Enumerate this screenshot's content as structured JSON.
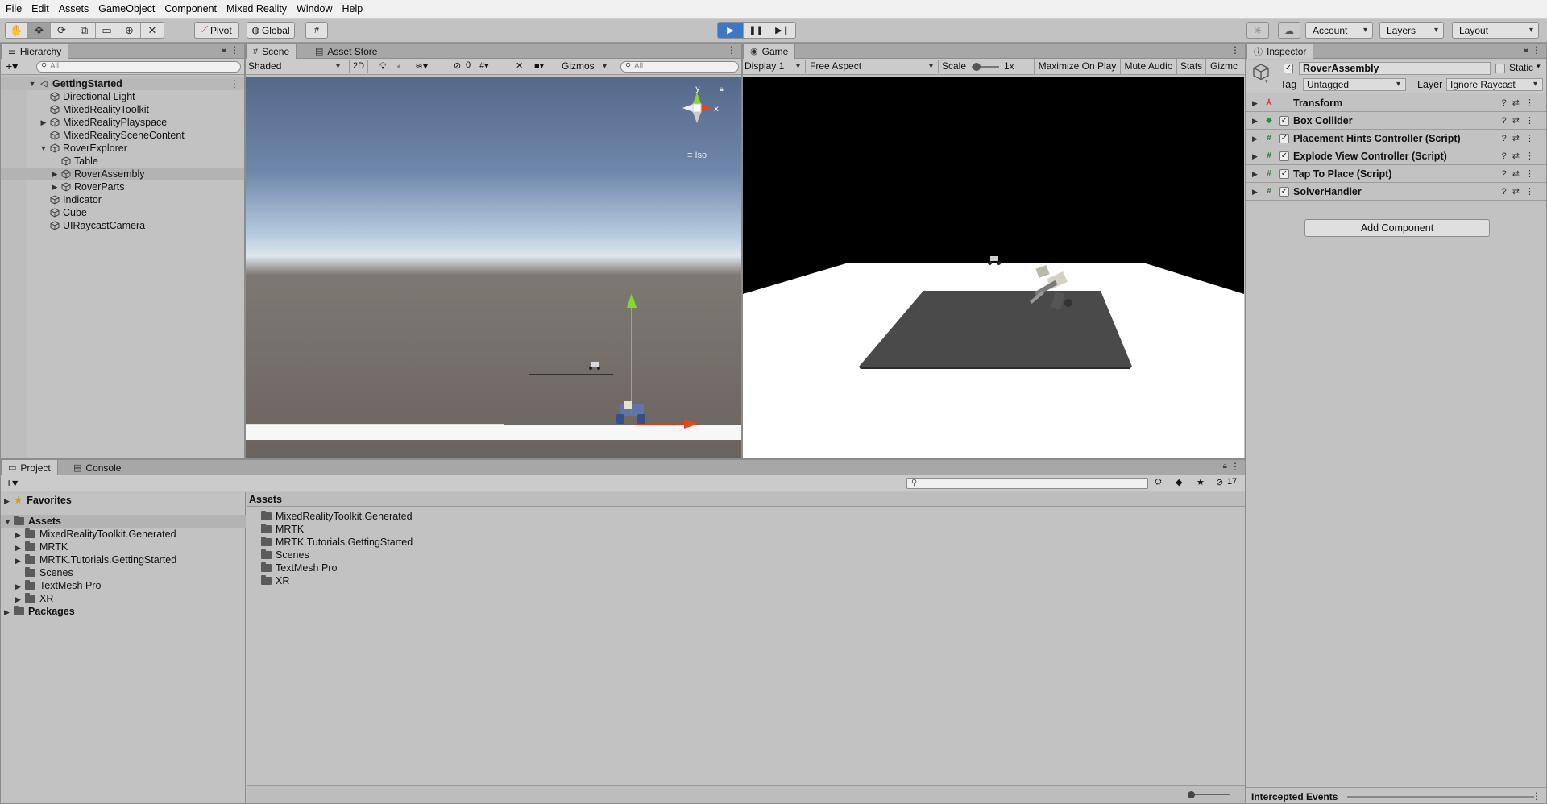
{
  "menu": [
    "File",
    "Edit",
    "Assets",
    "GameObject",
    "Component",
    "Mixed Reality",
    "Window",
    "Help"
  ],
  "toolbar": {
    "pivot": "Pivot",
    "global": "Global",
    "account": "Account",
    "layers": "Layers",
    "layout": "Layout"
  },
  "hierarchy": {
    "tab": "Hierarchy",
    "search_placeholder": "All",
    "scene": "GettingStarted",
    "items": [
      "Directional Light",
      "MixedRealityToolkit",
      "MixedRealityPlayspace",
      "MixedRealitySceneContent",
      "RoverExplorer",
      "Table",
      "RoverAssembly",
      "RoverParts",
      "Indicator",
      "Cube",
      "UIRaycastCamera"
    ]
  },
  "scene": {
    "tab": "Scene",
    "asset_store_tab": "Asset Store",
    "shading": "Shaded",
    "mode_2d": "2D",
    "hidden_count": "0",
    "gizmos": "Gizmos",
    "search_placeholder": "All",
    "gizmo_y": "y",
    "gizmo_x": "x",
    "iso": "Iso"
  },
  "game": {
    "tab": "Game",
    "display": "Display 1",
    "aspect": "Free Aspect",
    "scale_label": "Scale",
    "scale_value": "1x",
    "maximize": "Maximize On Play",
    "mute": "Mute Audio",
    "stats": "Stats",
    "gizmos": "Gizmc"
  },
  "inspector": {
    "tab": "Inspector",
    "object_name": "RoverAssembly",
    "static_label": "Static",
    "tag_label": "Tag",
    "tag_value": "Untagged",
    "layer_label": "Layer",
    "layer_value": "Ignore Raycast",
    "components": [
      "Transform",
      "Box Collider",
      "Placement Hints Controller (Script)",
      "Explode View Controller (Script)",
      "Tap To Place (Script)",
      "SolverHandler"
    ],
    "add_component": "Add Component",
    "intercepted_events": "Intercepted Events"
  },
  "project": {
    "tab": "Project",
    "console_tab": "Console",
    "hidden_count": "17",
    "favorites": "Favorites",
    "assets": "Assets",
    "asset_folders": [
      "MixedRealityToolkit.Generated",
      "MRTK",
      "MRTK.Tutorials.GettingStarted",
      "Scenes",
      "TextMesh Pro",
      "XR"
    ],
    "packages": "Packages",
    "breadcrumb": "Assets"
  }
}
